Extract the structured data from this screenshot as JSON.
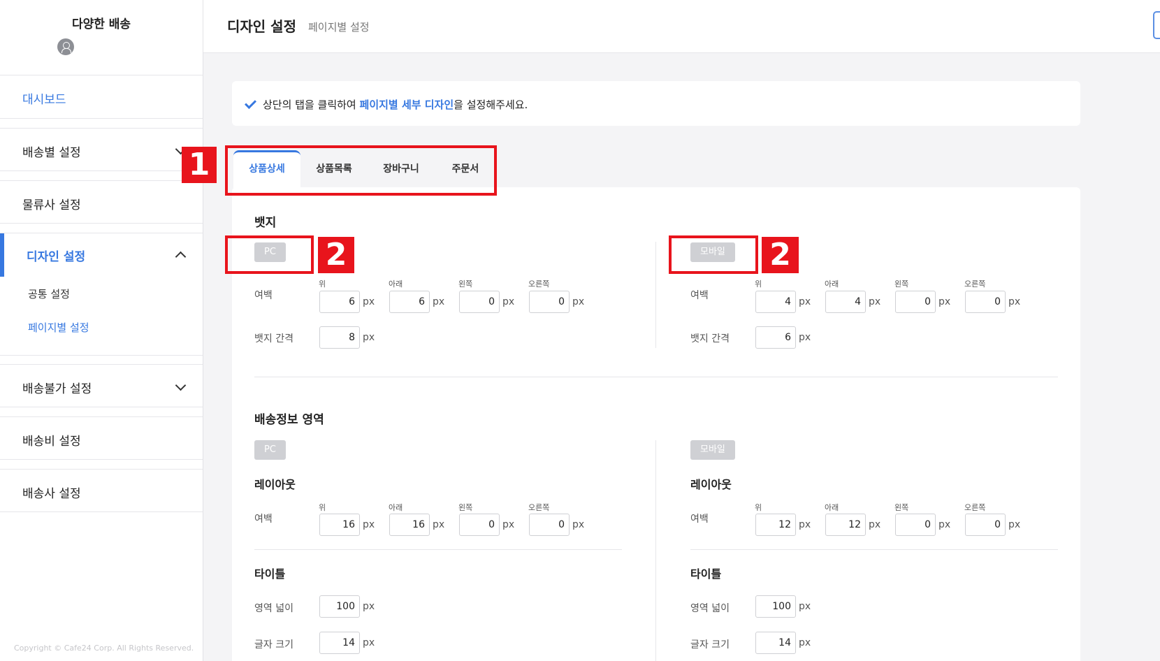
{
  "sidebar": {
    "brand": "다양한 배송",
    "menu": {
      "dashboard": "대시보드",
      "shipping": "배송별 설정",
      "logistics": "물류사 설정",
      "design": "디자인 설정",
      "design_common": "공통 설정",
      "design_page": "페이지별 설정",
      "undeliverable": "배송불가 설정",
      "shipping_fee": "배송비 설정",
      "carrier": "배송사 설정"
    },
    "copyright": "Copyright © Cafe24 Corp. All Rights Reserved."
  },
  "header": {
    "title": "디자인 설정",
    "subtitle": "페이지별 설정"
  },
  "notice": {
    "before": "상단의 탭을 클릭하여 ",
    "highlight": "페이지별 세부 디자인",
    "after": "을 설정해주세요."
  },
  "tabs": [
    "상품상세",
    "상품목록",
    "장바구니",
    "주문서"
  ],
  "annotations": {
    "one": "1",
    "two": "2"
  },
  "badge_section": {
    "title": "뱃지",
    "pc": {
      "label": "PC",
      "margin_label": "여백",
      "cols": [
        "위",
        "아래",
        "왼쪽",
        "오른쪽"
      ],
      "margins": [
        "6",
        "6",
        "0",
        "0"
      ],
      "gap_label": "뱃지 간격",
      "gap": "8",
      "unit": "px"
    },
    "mobile": {
      "label": "모바일",
      "margin_label": "여백",
      "cols": [
        "위",
        "아래",
        "왼쪽",
        "오른쪽"
      ],
      "margins": [
        "4",
        "4",
        "0",
        "0"
      ],
      "gap_label": "뱃지 간격",
      "gap": "6",
      "unit": "px"
    }
  },
  "shipping_info_section": {
    "title": "배송정보 영역",
    "pc": {
      "label": "PC",
      "layout_title": "레이아웃",
      "margin_label": "여백",
      "cols": [
        "위",
        "아래",
        "왼쪽",
        "오른쪽"
      ],
      "margins": [
        "16",
        "16",
        "0",
        "0"
      ],
      "title_title": "타이틀",
      "width_label": "영역 넓이",
      "width": "100",
      "font_label": "글자 크기",
      "font": "14",
      "unit": "px"
    },
    "mobile": {
      "label": "모바일",
      "layout_title": "레이아웃",
      "margin_label": "여백",
      "cols": [
        "위",
        "아래",
        "왼쪽",
        "오른쪽"
      ],
      "margins": [
        "12",
        "12",
        "0",
        "0"
      ],
      "title_title": "타이틀",
      "width_label": "영역 넓이",
      "width": "100",
      "font_label": "글자 크기",
      "font": "14",
      "unit": "px"
    }
  }
}
